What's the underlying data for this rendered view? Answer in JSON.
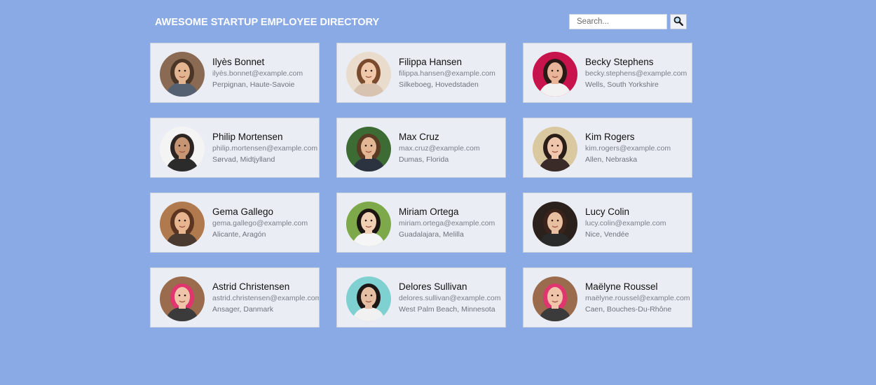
{
  "header": {
    "title": "AWESOME STARTUP EMPLOYEE DIRECTORY"
  },
  "search": {
    "placeholder": "Search...",
    "value": "",
    "button_icon": "magnifier-icon"
  },
  "employees": [
    {
      "name": "Ilyès Bonnet",
      "email": "ilyès.bonnet@example.com",
      "location": "Perpignan, Haute-Savoie",
      "avatar_bg": "#8a6a52",
      "avatar_skin": "#e2b48f",
      "avatar_hair": "#4a3526",
      "avatar_shirt": "#556070"
    },
    {
      "name": "Filippa Hansen",
      "email": "filippa.hansen@example.com",
      "location": "Silkeboeg, Hovedstaden",
      "avatar_bg": "#e9dccd",
      "avatar_skin": "#f0c9ab",
      "avatar_hair": "#7a4a2c",
      "avatar_shirt": "#d8c3b0"
    },
    {
      "name": "Becky Stephens",
      "email": "becky.stephens@example.com",
      "location": "Wells, South Yorkshire",
      "avatar_bg": "#c8144c",
      "avatar_skin": "#e8b59a",
      "avatar_hair": "#2a1a16",
      "avatar_shirt": "#f2f2f2"
    },
    {
      "name": "Philip Mortensen",
      "email": "philip.mortensen@example.com",
      "location": "Sørvad, Midtjylland",
      "avatar_bg": "#f4f4f4",
      "avatar_skin": "#c69574",
      "avatar_hair": "#2b2420",
      "avatar_shirt": "#2b2b2b"
    },
    {
      "name": "Max Cruz",
      "email": "max.cruz@example.com",
      "location": "Dumas, Florida",
      "avatar_bg": "#3d6b34",
      "avatar_skin": "#e3b694",
      "avatar_hair": "#5a3a22",
      "avatar_shirt": "#2c3340"
    },
    {
      "name": "Kim Rogers",
      "email": "kim.rogers@example.com",
      "location": "Allen, Nebraska",
      "avatar_bg": "#d9c8a0",
      "avatar_skin": "#efc6ac",
      "avatar_hair": "#2a1c16",
      "avatar_shirt": "#3a2b28"
    },
    {
      "name": "Gema Gallego",
      "email": "gema.gallego@example.com",
      "location": "Alicante, Aragón",
      "avatar_bg": "#b07a4e",
      "avatar_skin": "#e7b58f",
      "avatar_hair": "#5b3520",
      "avatar_shirt": "#4a3a30"
    },
    {
      "name": "Miriam Ortega",
      "email": "miriam.ortega@example.com",
      "location": "Guadalajara, Melilla",
      "avatar_bg": "#7da94a",
      "avatar_skin": "#f1d0b4",
      "avatar_hair": "#1d1512",
      "avatar_shirt": "#f5f5f5"
    },
    {
      "name": "Lucy Colin",
      "email": "lucy.colin@example.com",
      "location": "Nice, Vendée",
      "avatar_bg": "#2a201c",
      "avatar_skin": "#e9bfa2",
      "avatar_hair": "#3a231a",
      "avatar_shirt": "#2a2a2a"
    },
    {
      "name": "Astrid Christensen",
      "email": "astrid.christensen@example.com",
      "location": "Ansager, Danmark",
      "avatar_bg": "#9a6b4d",
      "avatar_skin": "#f0c4a8",
      "avatar_hair": "#e0356e",
      "avatar_shirt": "#3b3b3b"
    },
    {
      "name": "Delores Sullivan",
      "email": "delores.sullivan@example.com",
      "location": "West Palm Beach, Minnesota",
      "avatar_bg": "#7fd0d0",
      "avatar_skin": "#e5bfa4",
      "avatar_hair": "#1c1614",
      "avatar_shirt": "#f1f1f1"
    },
    {
      "name": "Maëlyne Roussel",
      "email": "maëlyne.roussel@example.com",
      "location": "Caen, Bouches-Du-Rhône",
      "avatar_bg": "#9a6b4d",
      "avatar_skin": "#f0c4a8",
      "avatar_hair": "#e0356e",
      "avatar_shirt": "#3b3b3b"
    }
  ]
}
